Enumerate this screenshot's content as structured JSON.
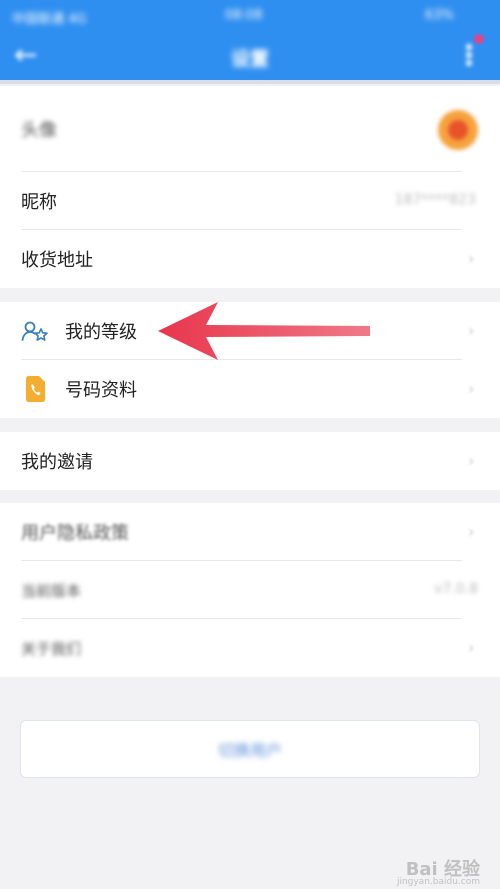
{
  "status_bar": {
    "carrier": "中国联通 4G",
    "time": "08:08",
    "battery": "63%"
  },
  "nav": {
    "title": "设置"
  },
  "profile": {
    "avatar_label": "头像",
    "nickname_label": "昵称",
    "nickname_value": "187****823",
    "address_label": "收货地址"
  },
  "account": {
    "level_label": "我的等级",
    "number_info_label": "号码资料"
  },
  "invite": {
    "label": "我的邀请"
  },
  "about": {
    "privacy_label": "用户隐私政策",
    "version_label": "当前版本",
    "version_value": "v7.0.8",
    "about_us_label": "关于我们"
  },
  "switch_user_label": "切换用户",
  "watermark": {
    "text": "Bai 经验",
    "domain": "jingyan.baidu.com"
  },
  "colors": {
    "header": "#2f8ff0",
    "arrow": "#e8354c",
    "level_icon": "#3a7fb8",
    "number_icon": "#f3ad30"
  }
}
